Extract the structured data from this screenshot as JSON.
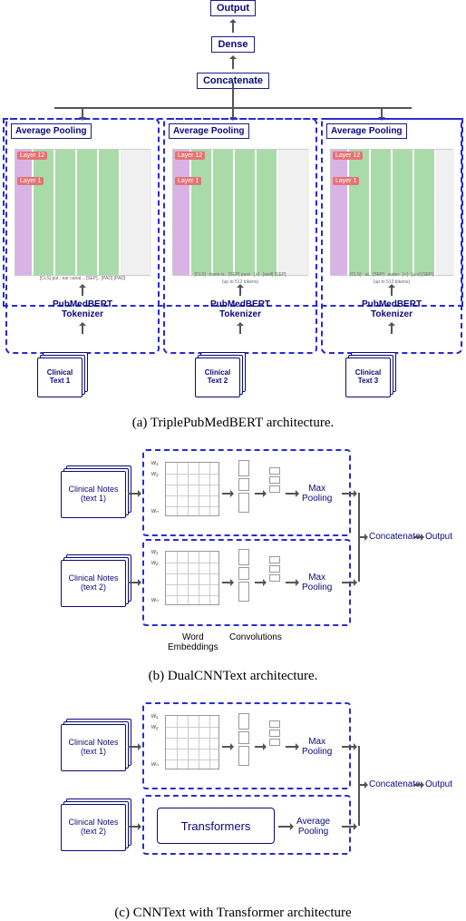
{
  "panel_a": {
    "output": "Output",
    "dense": "Dense",
    "concatenate": "Concatenate",
    "avg_pooling": "Average Pooling",
    "layer_top": "Layer 12",
    "layer_bottom": "Layer 1",
    "tokens_note_1": "[CLS] put.. ear canal... [SEP].. [PAD] [PAD]",
    "tokens_note_2": "[CLS] ..there is.. [SEP] pure.. [+] ..[well] [SEP]",
    "tokens_note_3": "[CLS] ..at.. [SEP] ..water.. [+] ..[a.o] [SEP]",
    "up_to": "(up to 512 tokens)",
    "tokenizer": "PubMedBERT\nTokenizer",
    "clinical1": "Clinical\nText 1",
    "clinical2": "Clinical\nText 2",
    "clinical3": "Clinical\nText 3",
    "caption": "(a) TriplePubMedBERT architecture."
  },
  "panel_b": {
    "notes1": "Clinical Notes\n(text 1)",
    "notes2": "Clinical Notes\n(text 2)",
    "maxpool": "Max\nPooling",
    "concat": "Concatenate",
    "output": "Output",
    "word_emb": "Word\nEmbeddings",
    "conv": "Convolutions",
    "w1": "w₁",
    "w2": "w₂",
    "wn": "wₙ",
    "caption": "(b) DualCNNText architecture."
  },
  "panel_c": {
    "notes1": "Clinical Notes\n(text 1)",
    "notes2": "Clinical Notes\n(text 2)",
    "maxpool": "Max\nPooling",
    "transformers": "Transformers",
    "avgpool": "Average\nPooling",
    "concat": "Concatenate",
    "output": "Output",
    "w1": "w₁",
    "w2": "w₂",
    "wn": "wₙ",
    "caption": "(c) CNNText with Transformer architecture"
  }
}
